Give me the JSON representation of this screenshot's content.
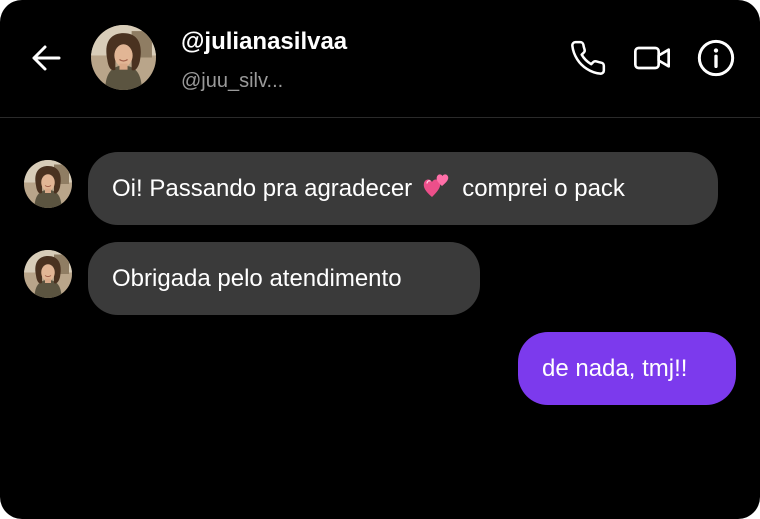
{
  "header": {
    "name": "@julianasilvaa",
    "handle": "@juu_silv..."
  },
  "icons": {
    "back": "arrow-left-icon",
    "call": "phone-icon",
    "video": "video-camera-icon",
    "info": "info-icon"
  },
  "messages": [
    {
      "direction": "in",
      "text_before": "Oi! Passando pra agradecer",
      "emoji": "two-hearts",
      "text_after": "comprei o pack"
    },
    {
      "direction": "in",
      "text": "Obrigada pelo atendimento"
    },
    {
      "direction": "out",
      "text": "de nada, tmj!!"
    }
  ],
  "colors": {
    "background": "#000000",
    "incoming_bubble": "#3a3a3a",
    "outgoing_bubble": "#7c3aed",
    "secondary_text": "#9a9a9a"
  }
}
